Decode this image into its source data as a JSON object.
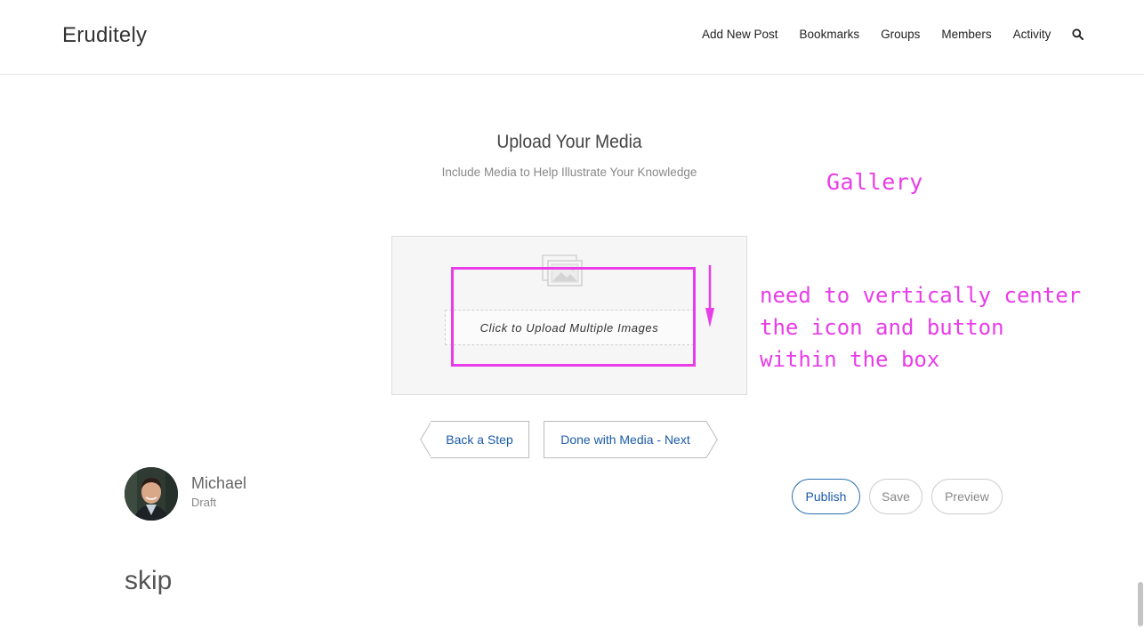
{
  "header": {
    "logo": "Eruditely",
    "nav": [
      {
        "label": "Add New Post"
      },
      {
        "label": "Bookmarks"
      },
      {
        "label": "Groups"
      },
      {
        "label": "Members"
      },
      {
        "label": "Activity"
      }
    ],
    "search_icon": "search-icon"
  },
  "upload": {
    "title": "Upload Your Media",
    "subtitle": "Include Media to Help Illustrate Your Knowledge",
    "button_label": "Click to Upload Multiple Images",
    "icon": "image-icon"
  },
  "annotations": {
    "gallery": "Gallery",
    "note_lines": [
      "need to vertically center",
      "the icon and button",
      "within the box"
    ],
    "color": "#e83de8"
  },
  "steps": {
    "back": "Back a Step",
    "next": "Done with Media - Next"
  },
  "author": {
    "name": "Michael",
    "status": "Draft"
  },
  "actions": {
    "publish": "Publish",
    "save": "Save",
    "preview": "Preview"
  },
  "content": {
    "heading": "skip"
  },
  "colors": {
    "link": "#1a5aa8",
    "annotation": "#e83de8"
  }
}
